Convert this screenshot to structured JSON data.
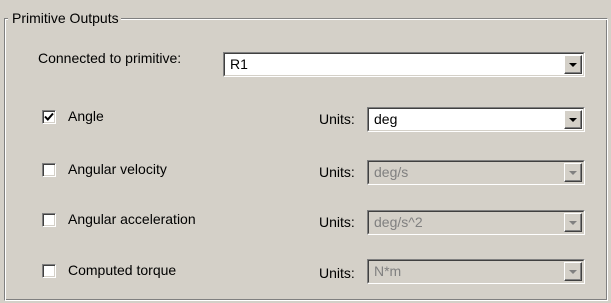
{
  "group": {
    "title": "Primitive Outputs"
  },
  "connected": {
    "label": "Connected to primitive:",
    "value": "R1"
  },
  "units_label": "Units:",
  "outputs": [
    {
      "label": "Angle",
      "checked": true,
      "units": "deg",
      "units_enabled": true
    },
    {
      "label": "Angular velocity",
      "checked": false,
      "units": "deg/s",
      "units_enabled": false
    },
    {
      "label": "Angular acceleration",
      "checked": false,
      "units": "deg/s^2",
      "units_enabled": false
    },
    {
      "label": "Computed torque",
      "checked": false,
      "units": "N*m",
      "units_enabled": false
    }
  ],
  "icons": {
    "dropdown": "chevron-down-icon",
    "check": "checkmark-icon"
  }
}
